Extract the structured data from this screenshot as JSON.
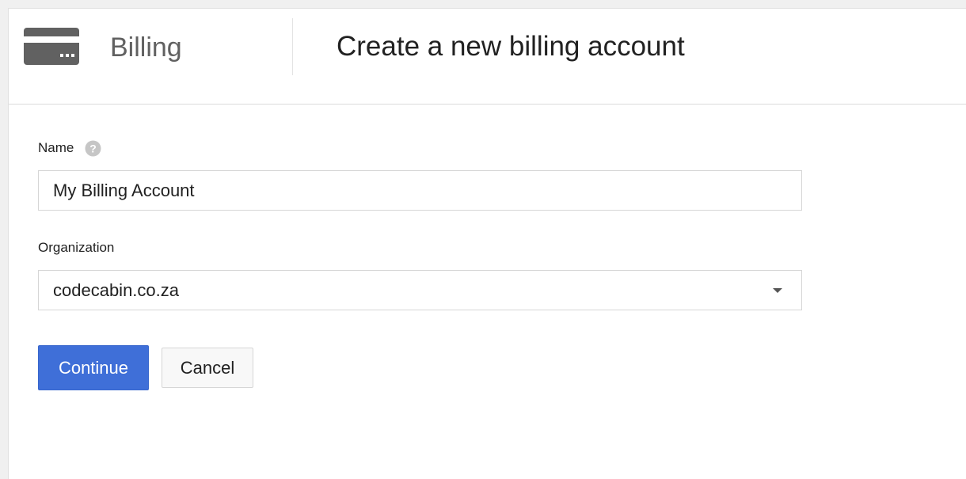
{
  "header": {
    "section_title": "Billing",
    "page_title": "Create a new billing account",
    "icon": "credit-card-icon"
  },
  "form": {
    "name": {
      "label": "Name",
      "help_icon": "help-circle-icon",
      "value": "My Billing Account"
    },
    "organization": {
      "label": "Organization",
      "selected": "codecabin.co.za",
      "icon": "chevron-down-icon"
    },
    "continue_label": "Continue",
    "cancel_label": "Cancel"
  },
  "colors": {
    "primary": "#3f6fd8",
    "icon_gray": "#616161"
  }
}
